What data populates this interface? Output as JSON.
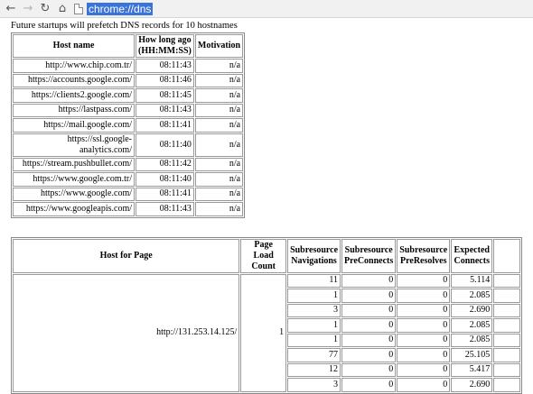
{
  "browser": {
    "url": "chrome://dns"
  },
  "intro_text": "Future startups will prefetch DNS records for 10 hostnames",
  "hostnames_table": {
    "headers": [
      "Host name",
      "How long ago (HH:MM:SS)",
      "Motivation"
    ],
    "rows": [
      {
        "host": "http://www.chip.com.tr/",
        "ago": "08:11:43",
        "motivation": "n/a"
      },
      {
        "host": "https://accounts.google.com/",
        "ago": "08:11:46",
        "motivation": "n/a"
      },
      {
        "host": "https://clients2.google.com/",
        "ago": "08:11:45",
        "motivation": "n/a"
      },
      {
        "host": "https://lastpass.com/",
        "ago": "08:11:43",
        "motivation": "n/a"
      },
      {
        "host": "https://mail.google.com/",
        "ago": "08:11:41",
        "motivation": "n/a"
      },
      {
        "host": "https://ssl.google-analytics.com/",
        "ago": "08:11:40",
        "motivation": "n/a"
      },
      {
        "host": "https://stream.pushbullet.com/",
        "ago": "08:11:42",
        "motivation": "n/a"
      },
      {
        "host": "https://www.google.com.tr/",
        "ago": "08:11:40",
        "motivation": "n/a"
      },
      {
        "host": "https://www.google.com/",
        "ago": "08:11:41",
        "motivation": "n/a"
      },
      {
        "host": "https://www.googleapis.com/",
        "ago": "08:11:43",
        "motivation": "n/a"
      }
    ]
  },
  "subresource_table": {
    "headers": [
      "Host for Page",
      "Page Load Count",
      "Subresource Navigations",
      "Subresource PreConnects",
      "Subresource PreResolves",
      "Expected Connects",
      ""
    ],
    "host_for_page": "http://131.253.14.125/",
    "page_load_count": "1",
    "rows": [
      {
        "nav": "11",
        "preconnects": "0",
        "preresolves": "0",
        "expected": "5.114"
      },
      {
        "nav": "1",
        "preconnects": "0",
        "preresolves": "0",
        "expected": "2.085"
      },
      {
        "nav": "3",
        "preconnects": "0",
        "preresolves": "0",
        "expected": "2.690"
      },
      {
        "nav": "1",
        "preconnects": "0",
        "preresolves": "0",
        "expected": "2.085"
      },
      {
        "nav": "1",
        "preconnects": "0",
        "preresolves": "0",
        "expected": "2.085"
      },
      {
        "nav": "77",
        "preconnects": "0",
        "preresolves": "0",
        "expected": "25.105"
      },
      {
        "nav": "12",
        "preconnects": "0",
        "preresolves": "0",
        "expected": "5.417"
      },
      {
        "nav": "3",
        "preconnects": "0",
        "preresolves": "0",
        "expected": "2.690"
      }
    ]
  }
}
